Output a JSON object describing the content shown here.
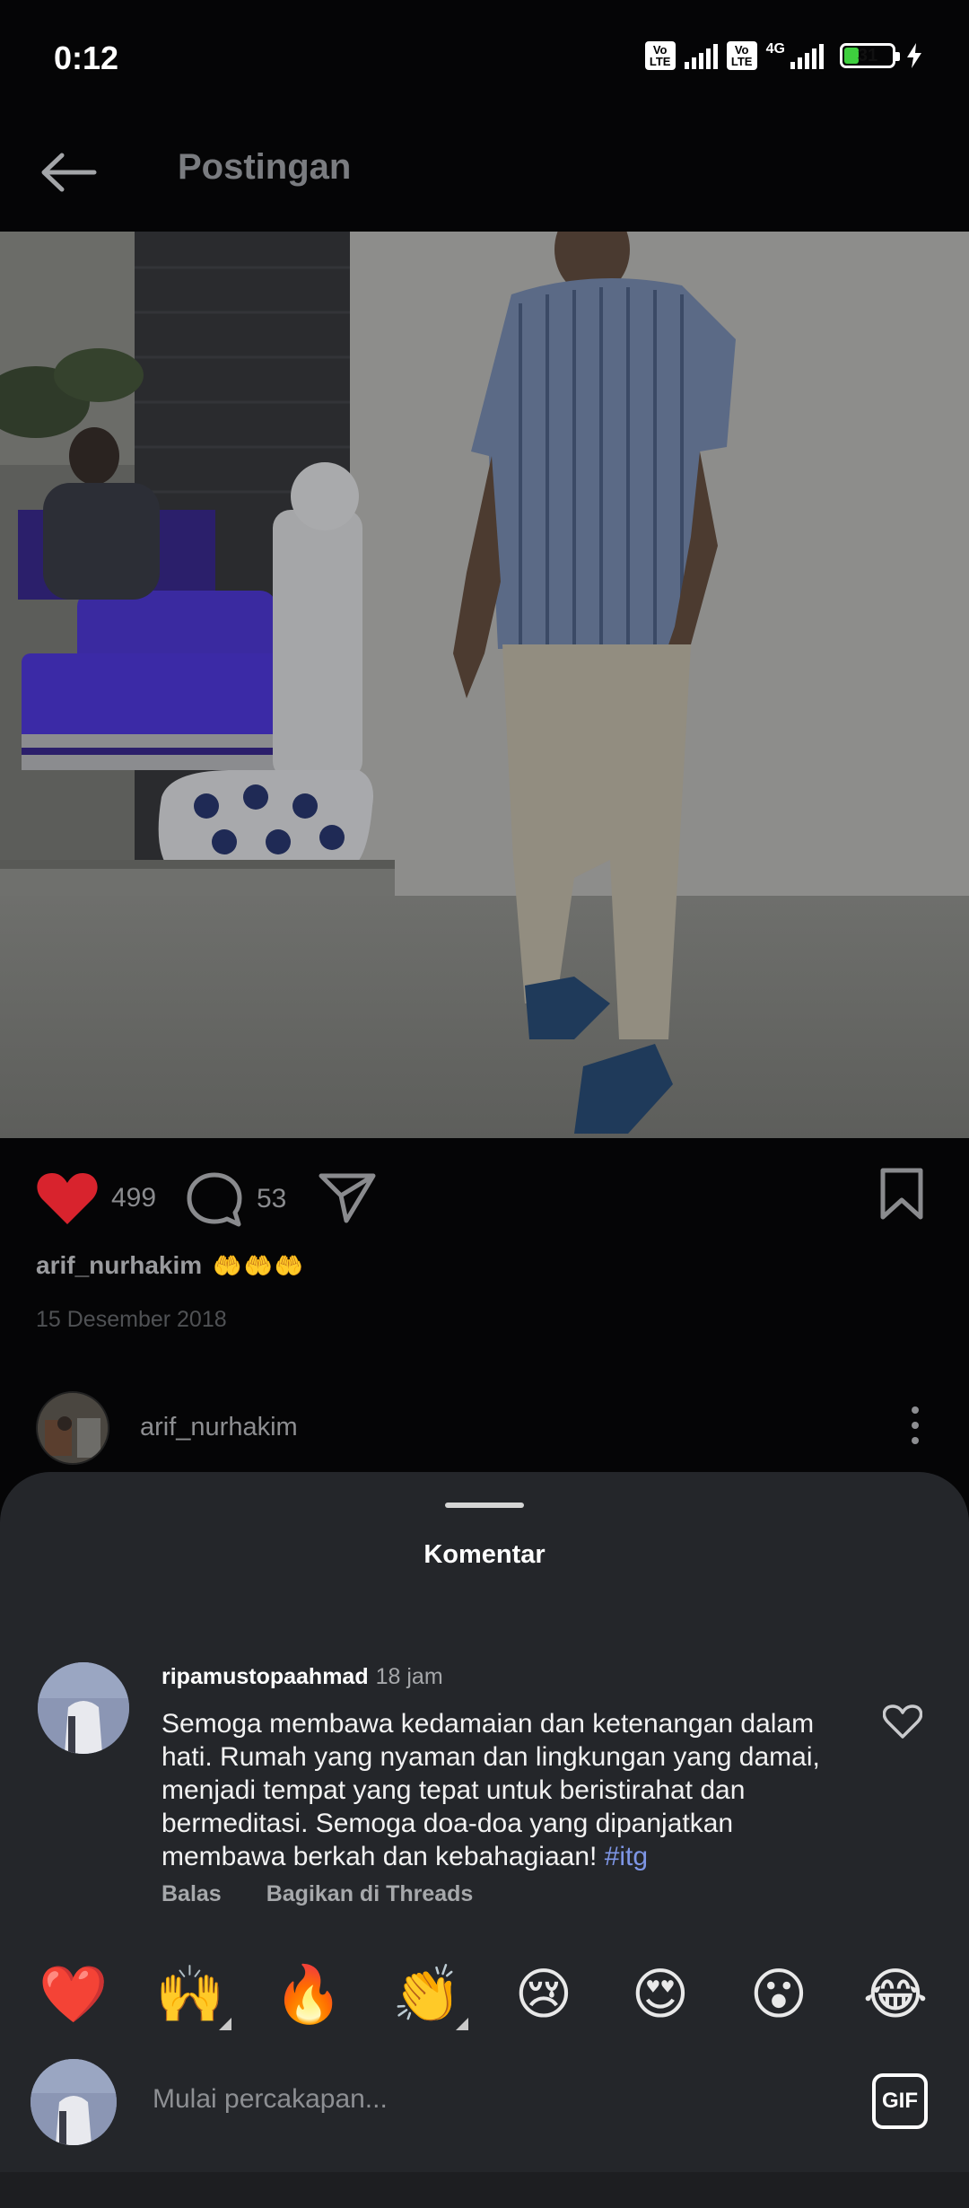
{
  "status_bar": {
    "time": "0:12",
    "volte_1": "Vo LTE",
    "volte_2": "Vo LTE",
    "network": "4G",
    "battery": "31",
    "battery_level": 0.31
  },
  "app_bar": {
    "title": "Postingan"
  },
  "post": {
    "likes": "499",
    "comments": "53",
    "author": "arif_nurhakim",
    "caption_emoji": "🤲🤲🤲",
    "date": "15 Desember 2018",
    "liked": true
  },
  "author_row": {
    "username": "arif_nurhakim"
  },
  "sheet": {
    "title": "Komentar",
    "comment": {
      "username": "ripamustopaahmad",
      "time": "18 jam",
      "text": "Semoga membawa kedamaian dan ketenangan dalam hati. Rumah yang nyaman dan lingkungan yang damai, menjadi tempat yang tepat untuk beristirahat dan bermeditasi. Semoga doa-doa yang dipanjatkan membawa berkah dan kebahagiaan!",
      "hashtag": "#itg",
      "reply": "Balas",
      "share": "Bagikan di Threads"
    },
    "emojis": [
      "❤️",
      "🙌",
      "🔥",
      "👏",
      "😢",
      "😍",
      "😮",
      "😂"
    ],
    "composer_placeholder": "Mulai percakapan...",
    "gif_label": "GIF"
  },
  "colors": {
    "background": "#050506",
    "sheet": "#24262a",
    "heart": "#d8232d",
    "hashtag": "#7e96e6",
    "battery": "#3ecf3e"
  },
  "icons": [
    "back-arrow-icon",
    "heart-icon",
    "comment-icon",
    "share-icon",
    "bookmark-icon",
    "more-icon",
    "heart-outline-icon",
    "gif-icon"
  ]
}
